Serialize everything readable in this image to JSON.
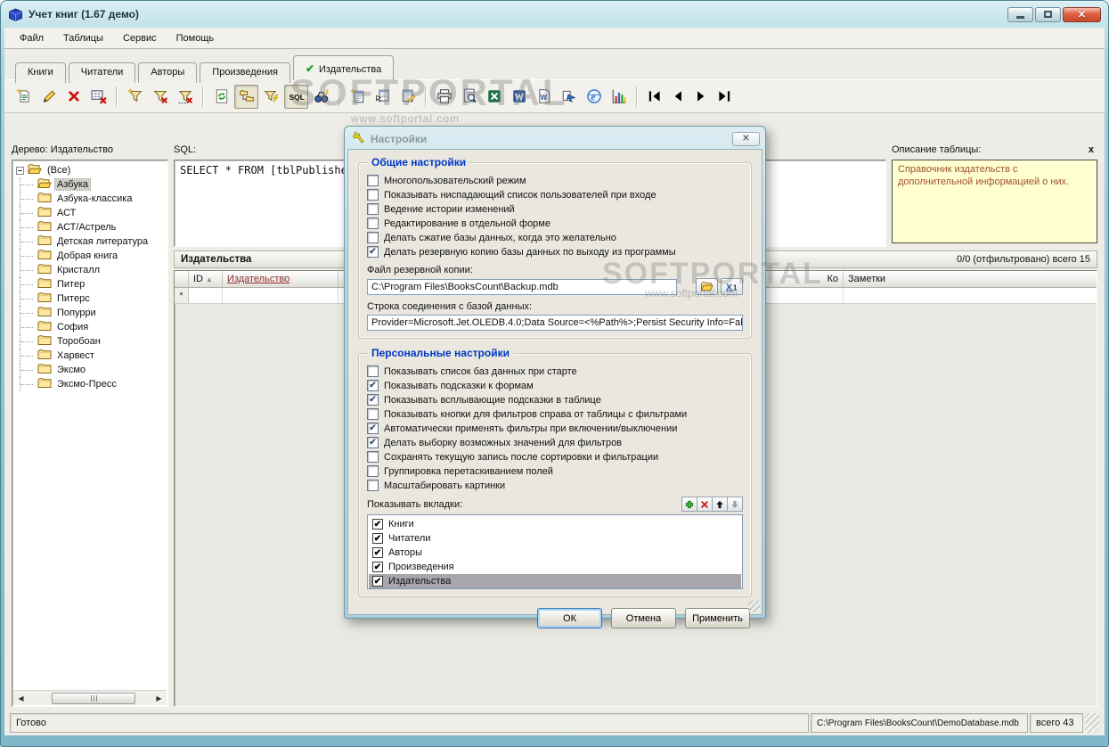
{
  "window": {
    "title": "Учет книг (1.67 демо)",
    "close_glyph": "✕"
  },
  "menu": {
    "items": [
      "Файл",
      "Таблицы",
      "Сервис",
      "Помощь"
    ]
  },
  "tabs": {
    "items": [
      {
        "label": "Книги",
        "active": false
      },
      {
        "label": "Читатели",
        "active": false
      },
      {
        "label": "Авторы",
        "active": false
      },
      {
        "label": "Произведения",
        "active": false
      },
      {
        "label": "Издательства",
        "active": true,
        "check_glyph": "✔"
      }
    ]
  },
  "toolbar": {
    "buttons": [
      {
        "name": "new-record",
        "icon": "new-record"
      },
      {
        "name": "edit-record",
        "icon": "edit-record"
      },
      {
        "name": "delete-record",
        "icon": "delete-record"
      },
      {
        "name": "delete-table-rows",
        "icon": "delete-table"
      },
      {
        "sep": true
      },
      {
        "name": "filter-new",
        "icon": "filter-new"
      },
      {
        "name": "filter-clear",
        "icon": "filter-clear"
      },
      {
        "name": "filter-clear-all",
        "icon": "filter-clear-all"
      },
      {
        "sep": true
      },
      {
        "name": "refresh",
        "icon": "refresh"
      },
      {
        "name": "tree-panel-toggle",
        "icon": "tree-panel",
        "pressed": true
      },
      {
        "name": "filter-apply",
        "icon": "filter-apply"
      },
      {
        "name": "sql-toggle",
        "icon": "sql",
        "pressed": true
      },
      {
        "name": "search",
        "icon": "search"
      },
      {
        "sep": true
      },
      {
        "name": "form-new",
        "icon": "form-new"
      },
      {
        "name": "form-open",
        "icon": "form-open"
      },
      {
        "name": "form-edit",
        "icon": "form-edit"
      },
      {
        "sep": true
      },
      {
        "name": "print",
        "icon": "print"
      },
      {
        "name": "print-preview",
        "icon": "print-preview"
      },
      {
        "name": "export-excel",
        "icon": "export-excel"
      },
      {
        "name": "export-word",
        "icon": "export-word"
      },
      {
        "name": "export-document",
        "icon": "export-doc"
      },
      {
        "name": "export-data",
        "icon": "export-data"
      },
      {
        "name": "open-browser",
        "icon": "browser"
      },
      {
        "name": "chart",
        "icon": "chart"
      },
      {
        "sep": true
      },
      {
        "name": "nav-first",
        "icon": "nav-first"
      },
      {
        "name": "nav-prev",
        "icon": "nav-prev"
      },
      {
        "name": "nav-next",
        "icon": "nav-next"
      },
      {
        "name": "nav-last",
        "icon": "nav-last"
      }
    ]
  },
  "sidebar": {
    "header": "Дерево: Издательство",
    "items": [
      {
        "label": "(Все)",
        "root": true,
        "open": true
      },
      {
        "label": "Азбука",
        "open": true,
        "selected": true
      },
      {
        "label": "Азбука-классика"
      },
      {
        "label": "АСТ"
      },
      {
        "label": "АСТ/Астрель"
      },
      {
        "label": "Детская литература"
      },
      {
        "label": "Добрая книга"
      },
      {
        "label": "Кристалл"
      },
      {
        "label": "Питер"
      },
      {
        "label": "Питерс"
      },
      {
        "label": "Попурри"
      },
      {
        "label": "София"
      },
      {
        "label": "Торобоан"
      },
      {
        "label": "Харвест"
      },
      {
        "label": "Эксмо"
      },
      {
        "label": "Эксмо-Пресс"
      }
    ]
  },
  "sql": {
    "label": "SQL:",
    "query": "SELECT * FROM [tblPublishers"
  },
  "description_panel": {
    "label": "Описание таблицы:",
    "close": "x",
    "text": "Справочник издательств с дополнительной информацией о них."
  },
  "grid": {
    "section_title": "Издательства",
    "filter_status": "0/0 (отфильтровано)  всего 15",
    "sort_icon": "▲",
    "columns": [
      "ID",
      "Издательство",
      "Ко",
      "Заметки"
    ],
    "new_row_marker": "*"
  },
  "dialog": {
    "title": "Настройки",
    "close_glyph": "✕",
    "general": {
      "title": "Общие настройки",
      "checkboxes": [
        {
          "label": "Многопользовательский режим",
          "checked": false
        },
        {
          "label": "Показывать ниспадающий список пользователей при входе",
          "checked": false
        },
        {
          "label": "Ведение истории изменений",
          "checked": false
        },
        {
          "label": "Редактирование в отдельной форме",
          "checked": false
        },
        {
          "label": "Делать сжатие базы данных, когда это желательно",
          "checked": false
        },
        {
          "label": "Делать резервную копию базы данных по выходу из программы",
          "checked": true
        }
      ],
      "backup_label": "Файл резервной копии:",
      "backup_path": "C:\\Program Files\\BooksCount\\Backup.mdb",
      "connection_label": "Строка соединения с базой данных:",
      "connection_string": "Provider=Microsoft.Jet.OLEDB.4.0;Data Source=<%Path%>;Persist Security Info=False"
    },
    "personal": {
      "title": "Персональные настройки",
      "checkboxes": [
        {
          "label": "Показывать список баз данных при старте",
          "checked": false
        },
        {
          "label": "Показывать подсказки к формам",
          "checked": true
        },
        {
          "label": "Показывать всплывающие подсказки в таблице",
          "checked": true
        },
        {
          "label": "Показывать кнопки для фильтров справа от таблицы с фильтрами",
          "checked": false
        },
        {
          "label": "Автоматически применять фильтры при включении/выключении",
          "checked": true
        },
        {
          "label": "Делать выборку возможных значений для фильтров",
          "checked": true
        },
        {
          "label": "Сохранять текущую запись после сортировки и фильтрации",
          "checked": false
        },
        {
          "label": "Группировка перетаскиванием полей",
          "checked": false
        },
        {
          "label": "Масштабировать картинки",
          "checked": false
        }
      ],
      "tabs_label": "Показывать вкладки:",
      "tabs_list": [
        {
          "label": "Книги",
          "checked": true
        },
        {
          "label": "Читатели",
          "checked": true
        },
        {
          "label": "Авторы",
          "checked": true
        },
        {
          "label": "Произведения",
          "checked": true
        },
        {
          "label": "Издательства",
          "checked": true,
          "selected": true
        }
      ]
    },
    "buttons": [
      {
        "label": "ОК",
        "default": true
      },
      {
        "label": "Отмена"
      },
      {
        "label": "Применить"
      }
    ]
  },
  "status_bar": {
    "ready": "Готово",
    "db_path": "C:\\Program Files\\BooksCount\\DemoDatabase.mdb",
    "total": "всего 43"
  },
  "watermark": {
    "title": "SOFTPORTAL",
    "url": "www.softportal.com"
  },
  "colors": {
    "frame_teal": "#8cc2d1",
    "active_check_green": "#18a018",
    "group_title_blue": "#0038c8",
    "description_text": "#a0522d",
    "sorted_column_red": "#93302e",
    "selection_gray": "#a6a6ab"
  }
}
